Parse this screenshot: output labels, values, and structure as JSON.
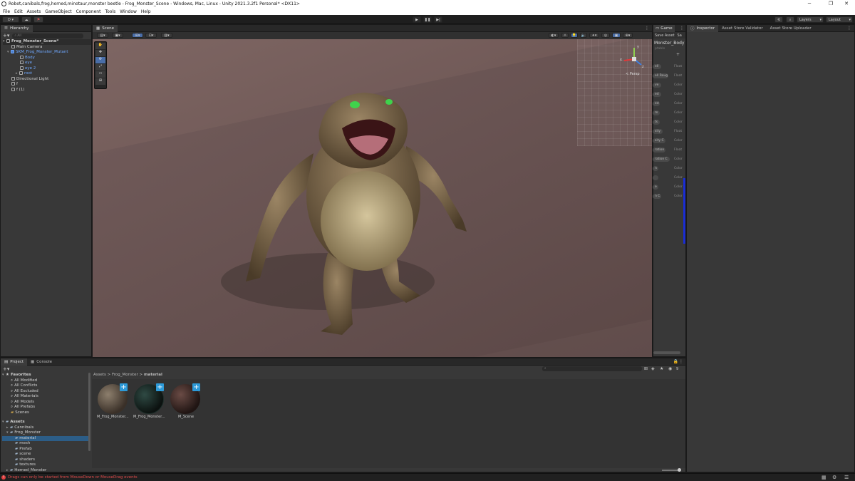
{
  "window": {
    "title": "Robot,canibals,frog,horned,minotaur,monster beetle - Frog_Monster_Scene - Windows, Mac, Linux - Unity 2021.3.2f1 Personal* <DX11>",
    "minimize": "─",
    "maximize": "❐",
    "close": "✕"
  },
  "menu": [
    "File",
    "Edit",
    "Assets",
    "GameObject",
    "Component",
    "Tools",
    "Window",
    "Help"
  ],
  "toolbar": {
    "account": "D ▾",
    "play_icon": "▶",
    "pause_icon": "❚❚",
    "step_icon": "▶|",
    "layers": "Layers",
    "layout": "Layout"
  },
  "hierarchy": {
    "tab": "Hierarchy",
    "search_placeholder": "All",
    "items": [
      {
        "label": "Frog_Monster_Scene*"
      },
      {
        "label": "Main Camera"
      },
      {
        "label": "SKM_Frog_Monster_Mutant"
      },
      {
        "label": "Body"
      },
      {
        "label": "eye"
      },
      {
        "label": "eye 2"
      },
      {
        "label": "root"
      },
      {
        "label": "Directional Light"
      },
      {
        "label": "f"
      },
      {
        "label": "f (1)"
      }
    ]
  },
  "scene": {
    "tab": "Scene",
    "persp_label": "< Persp",
    "gizmo_axes": {
      "y": "y",
      "x": "x",
      "z": "z"
    },
    "colors": {
      "x_axis": "#e0383a",
      "y_axis": "#8fd14f",
      "z_axis": "#3f7fe0"
    }
  },
  "game_panel": {
    "tab": "Game",
    "save_asset": "Save Asset",
    "sa_tab": "Sa",
    "object_name": "Monster_Body",
    "shader_text": "ptable",
    "props": [
      {
        "label": "ell Roug",
        "type": "Float"
      },
      {
        "label": "ve",
        "type": "Color"
      },
      {
        "label": "ed",
        "type": "Color"
      },
      {
        "label": "ed",
        "type": "Color"
      },
      {
        "label": "m",
        "type": "Color"
      },
      {
        "label": "ts",
        "type": "Color"
      },
      {
        "label": "sity",
        "type": "Float"
      },
      {
        "label": "sity C",
        "type": "Color"
      },
      {
        "label": "ration",
        "type": "Float"
      },
      {
        "label": "ration C",
        "type": "Color"
      },
      {
        "label": "n",
        "type": "Color"
      },
      {
        "label": "",
        "type": "Color"
      },
      {
        "label": "e",
        "type": "Color"
      },
      {
        "label": "n C",
        "type": "Color"
      }
    ],
    "first_prop": {
      "label": "ell",
      "type": "Float"
    }
  },
  "inspector": {
    "tabs": [
      "Inspector",
      "Asset Store Validator",
      "Asset Store Uploader"
    ]
  },
  "project": {
    "tabs": [
      "Project",
      "Console"
    ],
    "favorites_label": "Favorites",
    "favorites": [
      "All Modified",
      "All Conflicts",
      "All Excluded",
      "All Materials",
      "All Models",
      "All Prefabs",
      "Scenes"
    ],
    "assets_label": "Assets",
    "assets_tree": [
      {
        "label": "Cannibals"
      },
      {
        "label": "Frog_Monster"
      },
      {
        "label": "material"
      },
      {
        "label": "mesh"
      },
      {
        "label": "Prefab"
      },
      {
        "label": "scene"
      },
      {
        "label": "shaders"
      },
      {
        "label": "textures"
      },
      {
        "label": "Horned_Monster"
      }
    ],
    "breadcrumb": [
      "Assets",
      "Frog_Monster",
      "material"
    ],
    "breadcrumb_sep": ">",
    "materials": [
      {
        "name": "M_Frog_Monster..."
      },
      {
        "name": "M_Frog_Monster..."
      },
      {
        "name": "M_Scene"
      }
    ],
    "badge_count": "9"
  },
  "statusbar": {
    "error_text": "Drags can only be started from MouseDown or MouseDrag events"
  }
}
